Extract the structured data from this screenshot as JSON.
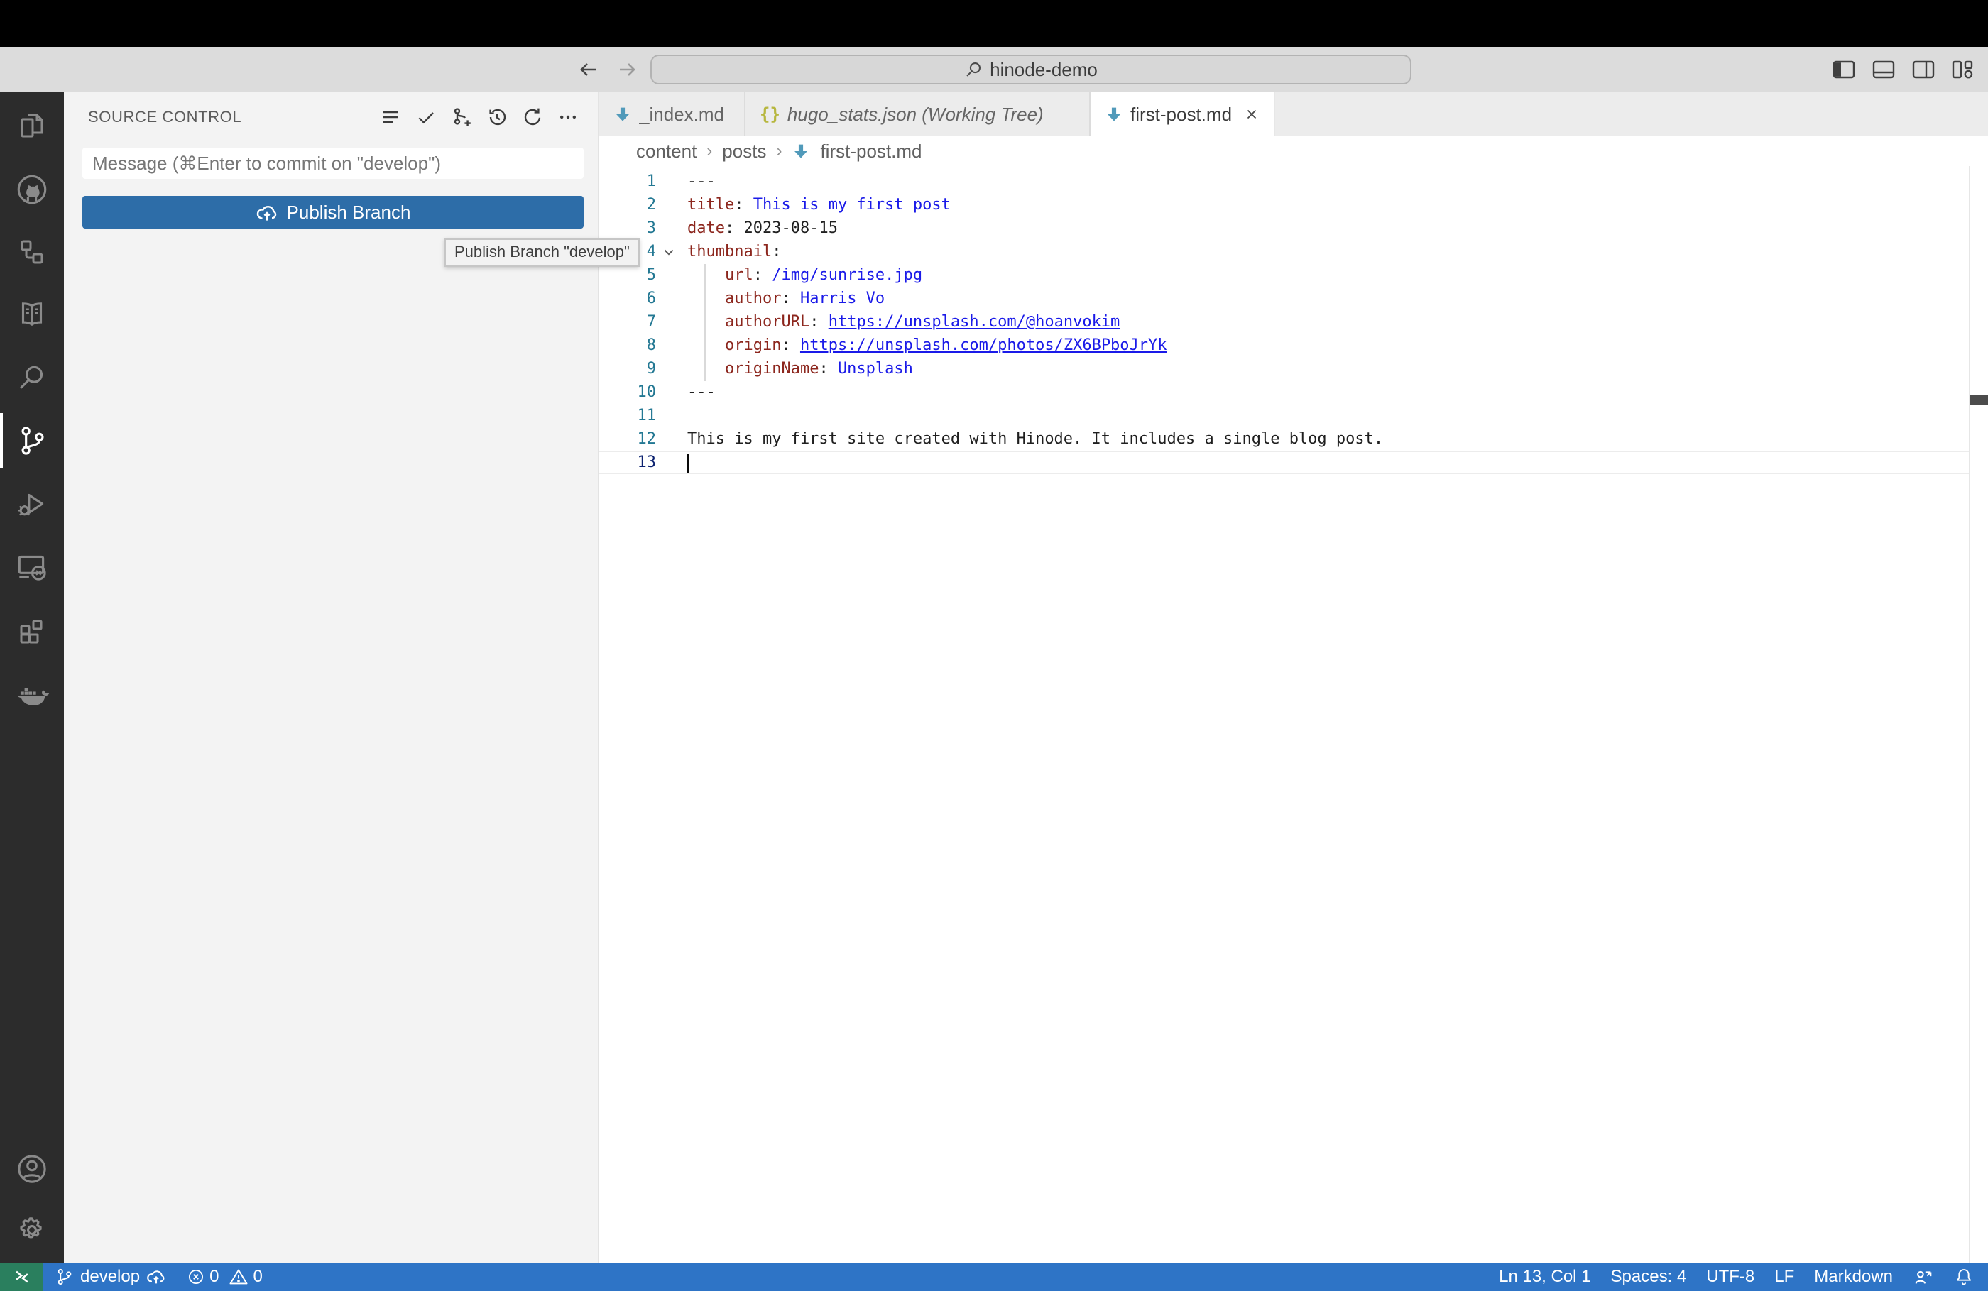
{
  "window": {
    "search_value": "hinode-demo"
  },
  "activity_bar": {
    "items": [
      "explorer",
      "github",
      "hierarchy",
      "docs",
      "search",
      "source-control",
      "run-debug",
      "remote-explorer",
      "extensions",
      "docker",
      "account",
      "settings"
    ]
  },
  "source_control": {
    "title": "SOURCE CONTROL",
    "message_placeholder": "Message (⌘Enter to commit on \"develop\")",
    "publish_label": "Publish Branch",
    "tooltip": "Publish Branch \"develop\""
  },
  "tabs": [
    {
      "label": "_index.md",
      "icon": "markdown",
      "active": false
    },
    {
      "label": "hugo_stats.json (Working Tree)",
      "icon": "json",
      "active": false,
      "italic": true
    },
    {
      "label": "first-post.md",
      "icon": "markdown",
      "active": true,
      "closable": true
    }
  ],
  "breadcrumb": {
    "folder1": "content",
    "folder2": "posts",
    "file": "first-post.md"
  },
  "editor": {
    "lines": [
      {
        "n": "1",
        "tokens": [
          {
            "t": "---",
            "s": "plain"
          }
        ]
      },
      {
        "n": "2",
        "tokens": [
          {
            "t": "title",
            "s": "key"
          },
          {
            "t": ": ",
            "s": "plain"
          },
          {
            "t": "This is my first post",
            "s": "str"
          }
        ]
      },
      {
        "n": "3",
        "tokens": [
          {
            "t": "date",
            "s": "key"
          },
          {
            "t": ": ",
            "s": "plain"
          },
          {
            "t": "2023-08-15",
            "s": "plain"
          }
        ]
      },
      {
        "n": "4",
        "tokens": [
          {
            "t": "thumbnail",
            "s": "key"
          },
          {
            "t": ":",
            "s": "plain"
          }
        ],
        "fold": true
      },
      {
        "n": "5",
        "tokens": [
          {
            "t": "    ",
            "s": "plain"
          },
          {
            "t": "url",
            "s": "key"
          },
          {
            "t": ": ",
            "s": "plain"
          },
          {
            "t": "/img/sunrise.jpg",
            "s": "str"
          }
        ]
      },
      {
        "n": "6",
        "tokens": [
          {
            "t": "    ",
            "s": "plain"
          },
          {
            "t": "author",
            "s": "key"
          },
          {
            "t": ": ",
            "s": "plain"
          },
          {
            "t": "Harris Vo",
            "s": "str"
          }
        ]
      },
      {
        "n": "7",
        "tokens": [
          {
            "t": "    ",
            "s": "plain"
          },
          {
            "t": "authorURL",
            "s": "key"
          },
          {
            "t": ": ",
            "s": "plain"
          },
          {
            "t": "https://unsplash.com/@hoanvokim",
            "s": "link"
          }
        ]
      },
      {
        "n": "8",
        "tokens": [
          {
            "t": "    ",
            "s": "plain"
          },
          {
            "t": "origin",
            "s": "key"
          },
          {
            "t": ": ",
            "s": "plain"
          },
          {
            "t": "https://unsplash.com/photos/ZX6BPboJrYk",
            "s": "link"
          }
        ]
      },
      {
        "n": "9",
        "tokens": [
          {
            "t": "    ",
            "s": "plain"
          },
          {
            "t": "originName",
            "s": "key"
          },
          {
            "t": ": ",
            "s": "plain"
          },
          {
            "t": "Unsplash",
            "s": "str"
          }
        ]
      },
      {
        "n": "10",
        "tokens": [
          {
            "t": "---",
            "s": "plain"
          }
        ]
      },
      {
        "n": "11",
        "tokens": []
      },
      {
        "n": "12",
        "tokens": [
          {
            "t": "This is my first site created with Hinode. It includes a single blog post.",
            "s": "plain"
          }
        ]
      },
      {
        "n": "13",
        "tokens": [],
        "active": true
      }
    ]
  },
  "status_bar": {
    "branch": "develop",
    "errors": "0",
    "warnings": "0",
    "right_items": [
      "Ln 13, Col 1",
      "Spaces: 4",
      "UTF-8",
      "LF",
      "Markdown"
    ]
  },
  "colors": {
    "status_bar": "#2e74c6",
    "remote_indicator": "#2a7f5e",
    "publish_button": "#2d6da8",
    "markdown_icon": "#519aba",
    "json_icon": "#b7b73f",
    "yaml_key": "#8c261d",
    "yaml_string": "#1a1ae8"
  }
}
